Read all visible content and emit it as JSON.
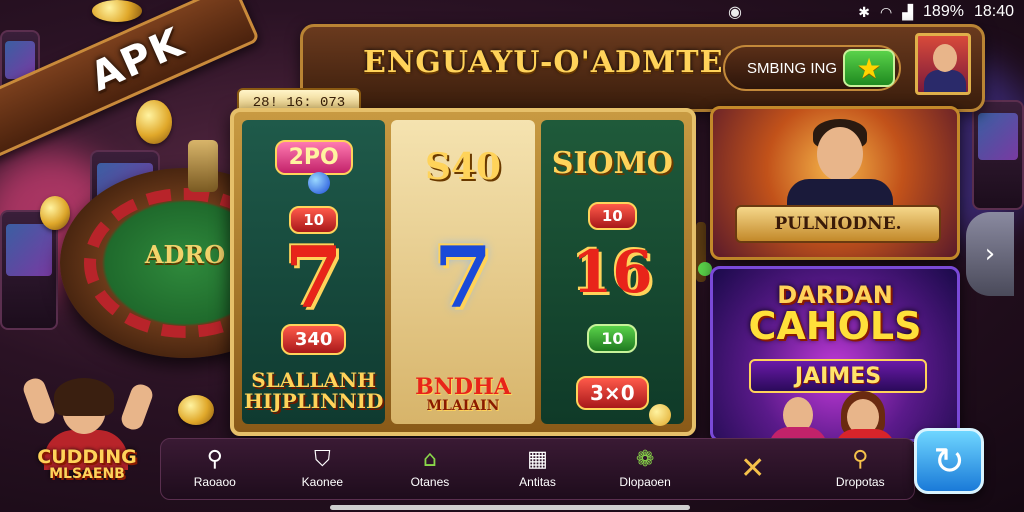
{
  "status_bar": {
    "battery": "189%",
    "time": "18:40",
    "icons": [
      "record-icon",
      "bluetooth-icon",
      "wifi-icon",
      "signal-icon"
    ]
  },
  "ribbon": {
    "label": "APK"
  },
  "header": {
    "title": "ENGUAYU-O'ADMTE",
    "pill_label": "SMBING ING",
    "star_icon": "star-icon",
    "avatar_icon": "avatar"
  },
  "timer": {
    "value": "28! 16: 073"
  },
  "roulette": {
    "label": "ADRO"
  },
  "slot": {
    "reel1": {
      "top": "2PO",
      "badge": "10",
      "seven": "7",
      "chip": "340",
      "title_line1": "SLALLANH",
      "title_line2": "HIJPLINNID"
    },
    "reel2": {
      "top": "S40",
      "seven": "7",
      "title_line1": "BNDHA",
      "title_line2": "MLAIAIN"
    },
    "reel3": {
      "top": "SIOMO",
      "badge": "10",
      "big": "16",
      "chip": "10",
      "bottom": "3×0"
    }
  },
  "cards": {
    "card1": {
      "banner": "PULNIODNE."
    },
    "card2": {
      "line1": "DARDAN",
      "line2": "CAHOLS",
      "ribbon": "JAIMES"
    }
  },
  "character": {
    "line1": "CUDDING",
    "line2": "MLSAENB"
  },
  "nav": {
    "items": [
      {
        "label": "Raoaoo",
        "icon": "search-icon"
      },
      {
        "label": "Kaonee",
        "icon": "shield-icon"
      },
      {
        "label": "Otanes",
        "icon": "home-icon"
      },
      {
        "label": "Antitas",
        "icon": "grid-icon"
      },
      {
        "label": "Dlopaoen",
        "icon": "wreath-icon"
      },
      {
        "label": "",
        "icon": "close-icon"
      },
      {
        "label": "Dropotas",
        "icon": "magnifier-icon"
      }
    ]
  },
  "colors": {
    "accent_gold": "#ffd35a",
    "wood": "#6a3a1e",
    "nav_bg": "#2a1226",
    "refresh": "#1a7ad8"
  }
}
